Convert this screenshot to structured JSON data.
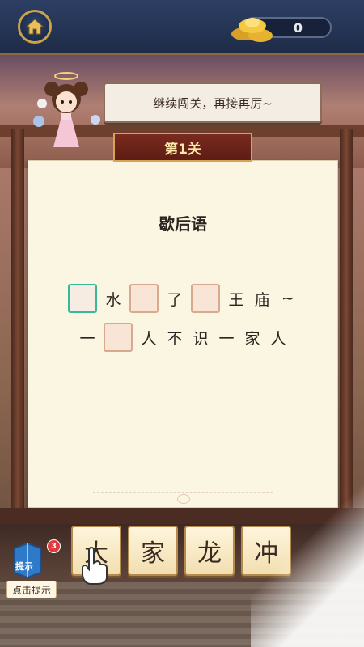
{
  "topbar": {
    "coins": "0",
    "home_icon": "home-icon",
    "coin_icon": "gold-ingot-icon"
  },
  "speech": {
    "text": "继续闯关，再接再厉~"
  },
  "level": {
    "label": "第1关"
  },
  "puzzle": {
    "title": "歇后语",
    "line1": [
      "水",
      "了",
      "王",
      "庙",
      "~"
    ],
    "line2": [
      "一",
      "人",
      "不",
      "识",
      "一",
      "家",
      "人"
    ]
  },
  "hint": {
    "label": "提示",
    "badge": "3",
    "caption": "点击提示"
  },
  "tiles": [
    "大",
    "家",
    "龙",
    "冲"
  ],
  "colors": {
    "active_slot": "#36b89a",
    "slot_border": "#d8a98f",
    "banner_bg": "#7a2a1e",
    "banner_text": "#ffe8a8"
  }
}
